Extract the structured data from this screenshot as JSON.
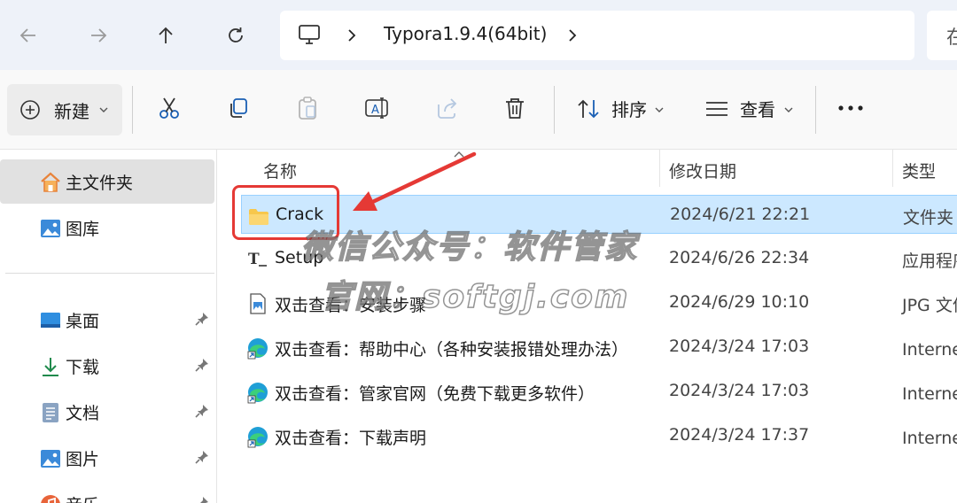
{
  "address_bar": {
    "crumb": "Typora1.9.4(64bit)",
    "search_hint": "在"
  },
  "toolbar": {
    "new_label": "新建",
    "sort_label": "排序",
    "view_label": "查看"
  },
  "sidebar": {
    "items": [
      {
        "label": "主文件夹",
        "icon": "home-icon"
      },
      {
        "label": "图库",
        "icon": "gallery-icon"
      },
      {
        "label": "桌面",
        "icon": "desktop-icon"
      },
      {
        "label": "下载",
        "icon": "download-icon"
      },
      {
        "label": "文档",
        "icon": "document-icon"
      },
      {
        "label": "图片",
        "icon": "pictures-icon"
      },
      {
        "label": "音乐",
        "icon": "music-icon"
      }
    ]
  },
  "columns": {
    "name": "名称",
    "date": "修改日期",
    "type": "类型"
  },
  "files": [
    {
      "name": "Crack",
      "date": "2024/6/21 22:21",
      "type": "文件夹",
      "icon": "folder-icon"
    },
    {
      "name": "Setup",
      "date": "2024/6/26 22:34",
      "type": "应用程序",
      "icon": "application-icon"
    },
    {
      "name": "双击查看：安装步骤",
      "date": "2024/6/29 10:10",
      "type": "JPG 文件",
      "icon": "image-file-icon"
    },
    {
      "name": "双击查看：帮助中心（各种安装报错处理办法）",
      "date": "2024/3/24 17:03",
      "type": "Internet 快捷方式",
      "icon": "edge-shortcut-icon"
    },
    {
      "name": "双击查看：管家官网（免费下载更多软件）",
      "date": "2024/3/24 17:03",
      "type": "Internet 快捷方式",
      "icon": "edge-shortcut-icon"
    },
    {
      "name": "双击查看：下载声明",
      "date": "2024/3/24 17:37",
      "type": "Internet 快捷方式",
      "icon": "edge-shortcut-icon"
    }
  ],
  "watermark": {
    "line1": "微信公众号：软件管家",
    "line2": "官网：softgj.com"
  },
  "colors": {
    "selection_bg": "#cce8ff",
    "annotation_red": "#e53935",
    "folder_yellow": "#f7c74c"
  }
}
